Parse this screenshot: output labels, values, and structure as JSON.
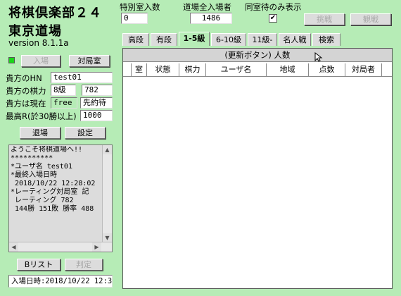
{
  "app": {
    "title_line1": "将棋倶楽部２４",
    "title_line2": "東京道場",
    "version": "version 8.1.1a"
  },
  "header": {
    "special_room_label": "特別室入数",
    "special_room_value": "0",
    "dojo_total_label": "道場全入場者",
    "dojo_total_value": "1486",
    "same_room_label": "同室待のみ表示",
    "same_room_checked": "✔",
    "button_decline": "挑戦",
    "button_watch": "観戦"
  },
  "left": {
    "enter_button": "入場",
    "match_room_button": "対局室",
    "hn_label": "貴方のHN",
    "hn_value": "test01",
    "rating_label": "貴方の棋力",
    "rank_value": "8級",
    "rating_value": "782",
    "status_label": "貴方は現在",
    "status_value": "free",
    "status_mode": "先約待",
    "max_r_label": "最高R(於30勝以上)",
    "max_r_value": "1000",
    "exit_button": "退場",
    "settings_button": "設定",
    "messages": [
      "ようこそ将棋道場へ!!",
      "**********",
      "*ユーザ名 test01",
      "*最終入場日時",
      " 2018/10/22 12:28:02",
      "*レーティング対局室 記",
      " レーティング 782",
      " 144勝 151敗 勝率 488"
    ],
    "b_list_button": "Bリスト",
    "judge_button": "判定",
    "entry_time": "入場日時:2018/10/22 12:3"
  },
  "tabs": [
    "高段",
    "有段",
    "1-5級",
    "6-10級",
    "11級-",
    "名人戦",
    "検索"
  ],
  "table": {
    "refresh_label": "(更新ボタン) 人数",
    "columns": [
      "",
      "室",
      "状態",
      "棋力",
      "ユーザ名",
      "地域",
      "点数",
      "対局者"
    ]
  },
  "colors": {
    "background": "#b6ecb6",
    "indicator": "#19d619"
  }
}
